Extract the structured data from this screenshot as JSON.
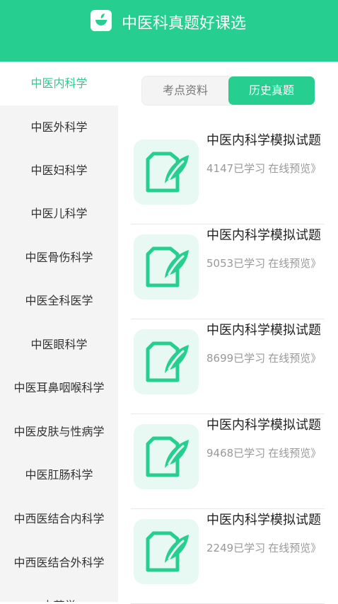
{
  "header": {
    "title": "中医科真题好课选",
    "icon": "herb-bowl-icon"
  },
  "sidebar": {
    "items": [
      {
        "label": "中医内科学",
        "active": true
      },
      {
        "label": "中医外科学"
      },
      {
        "label": "中医妇科学"
      },
      {
        "label": "中医儿科学"
      },
      {
        "label": "中医骨伤科学"
      },
      {
        "label": "中医全科医学"
      },
      {
        "label": "中医眼科学"
      },
      {
        "label": "中医耳鼻咽喉科学"
      },
      {
        "label": "中医皮肤与性病学"
      },
      {
        "label": "中医肛肠科学"
      },
      {
        "label": "中西医结合内科学"
      },
      {
        "label": "中西医结合外科学"
      },
      {
        "label": "中药学"
      }
    ]
  },
  "tabs": [
    {
      "label": "考点资料",
      "active": false
    },
    {
      "label": "历史真题",
      "active": true
    }
  ],
  "courses": [
    {
      "title": "中医内科学模拟试题",
      "count": "4147已学习",
      "preview": "在线预览》",
      "icon": "document-feather-icon"
    },
    {
      "title": "中医内科学模拟试题",
      "count": "5053已学习",
      "preview": "在线预览》",
      "icon": "document-feather-icon"
    },
    {
      "title": "中医内科学模拟试题",
      "count": "8699已学习",
      "preview": "在线预览》",
      "icon": "document-feather-icon"
    },
    {
      "title": "中医内科学模拟试题",
      "count": "9468已学习",
      "preview": "在线预览》",
      "icon": "document-feather-icon"
    },
    {
      "title": "中医内科学模拟试题",
      "count": "2249已学习",
      "preview": "在线预览》",
      "icon": "document-feather-icon"
    }
  ],
  "colors": {
    "accent": "#26cf8f",
    "sidebar_bg": "#f4f4f4",
    "thumb_bg": "#e7f9f2"
  }
}
